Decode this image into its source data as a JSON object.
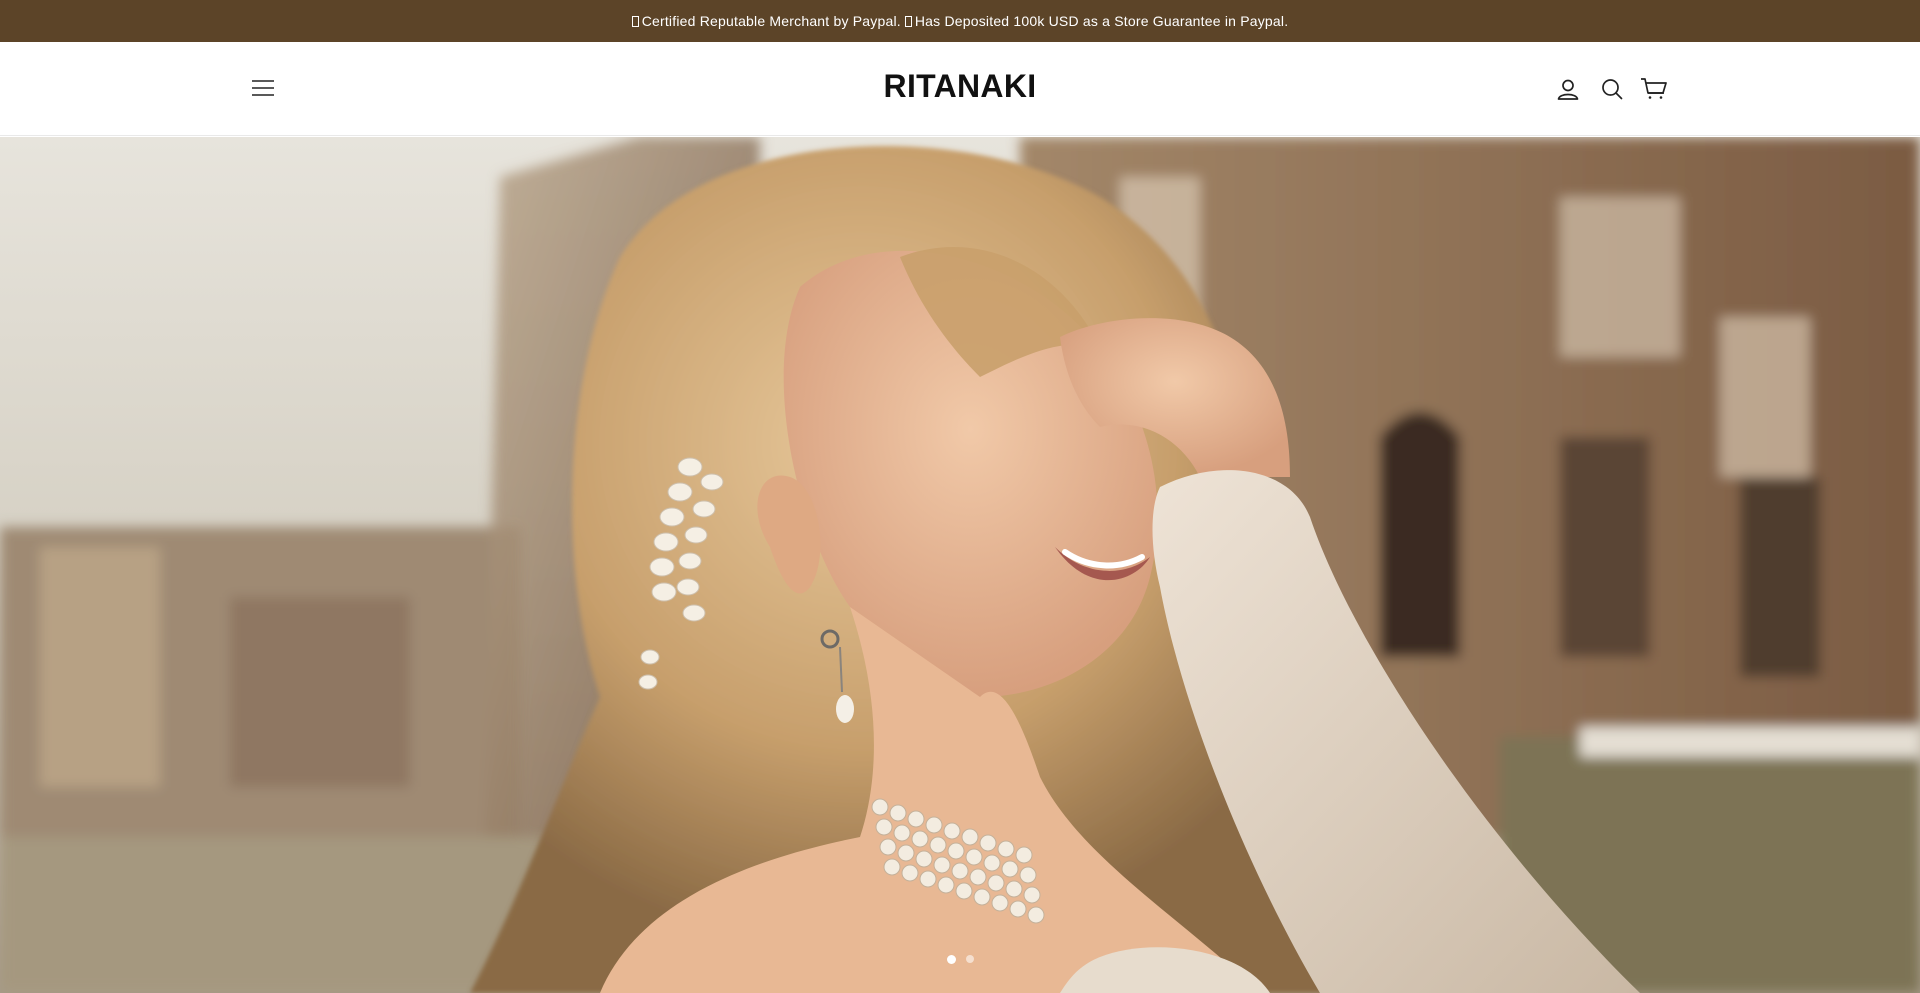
{
  "announcement": {
    "text_part1": "Certified Reputable Merchant by Paypal.",
    "text_part2": "Has Deposited 100k USD as a Store Guarantee in Paypal."
  },
  "header": {
    "logo": "RITANAKI",
    "icons": {
      "menu": "hamburger-menu-icon",
      "account": "user-icon",
      "search": "search-icon",
      "cart": "cart-icon"
    }
  },
  "hero": {
    "slide_count": 2,
    "active_slide": 1
  },
  "colors": {
    "announcement_bg": "#5c4428",
    "announcement_text": "#ffffff",
    "logo": "#111111"
  }
}
